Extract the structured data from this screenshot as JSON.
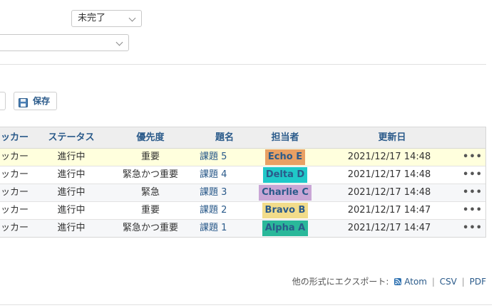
{
  "filters": {
    "status_select": "未完了",
    "second_select": ""
  },
  "toolbar": {
    "save_label": "保存"
  },
  "table": {
    "headers": {
      "tracker": "ッカー",
      "status": "ステータス",
      "priority": "優先度",
      "subject": "題名",
      "assignee": "担当者",
      "updated": "更新日"
    },
    "rows": [
      {
        "tracker": "ッカー",
        "status": "進行中",
        "priority": "重要",
        "subject": "課題 5",
        "assignee": "Echo E",
        "assignee_color": "#e8a064",
        "updated": "2021/12/17 14:48",
        "actions": "•••"
      },
      {
        "tracker": "ッカー",
        "status": "進行中",
        "priority": "緊急かつ重要",
        "subject": "課題 4",
        "assignee": "Delta D",
        "assignee_color": "#1fc8c8",
        "updated": "2021/12/17 14:48",
        "actions": "•••"
      },
      {
        "tracker": "ッカー",
        "status": "進行中",
        "priority": "緊急",
        "subject": "課題 3",
        "assignee": "Charlie C",
        "assignee_color": "#c9a6d6",
        "updated": "2021/12/17 14:48",
        "actions": "•••"
      },
      {
        "tracker": "ッカー",
        "status": "進行中",
        "priority": "重要",
        "subject": "課題 2",
        "assignee": "Bravo B",
        "assignee_color": "#f2dc8a",
        "updated": "2021/12/17 14:47",
        "actions": "•••"
      },
      {
        "tracker": "ッカー",
        "status": "進行中",
        "priority": "緊急かつ重要",
        "subject": "課題 1",
        "assignee": "Alpha A",
        "assignee_color": "#2ab89a",
        "updated": "2021/12/17 14:47",
        "actions": "•••"
      }
    ]
  },
  "export": {
    "label": "他の形式にエクスポート:",
    "atom": "Atom",
    "sep1": "|",
    "csv": "CSV",
    "sep2": "|",
    "pdf": "PDF"
  },
  "icons": {
    "save": "floppy-disk-icon",
    "feed": "rss-feed-icon"
  }
}
